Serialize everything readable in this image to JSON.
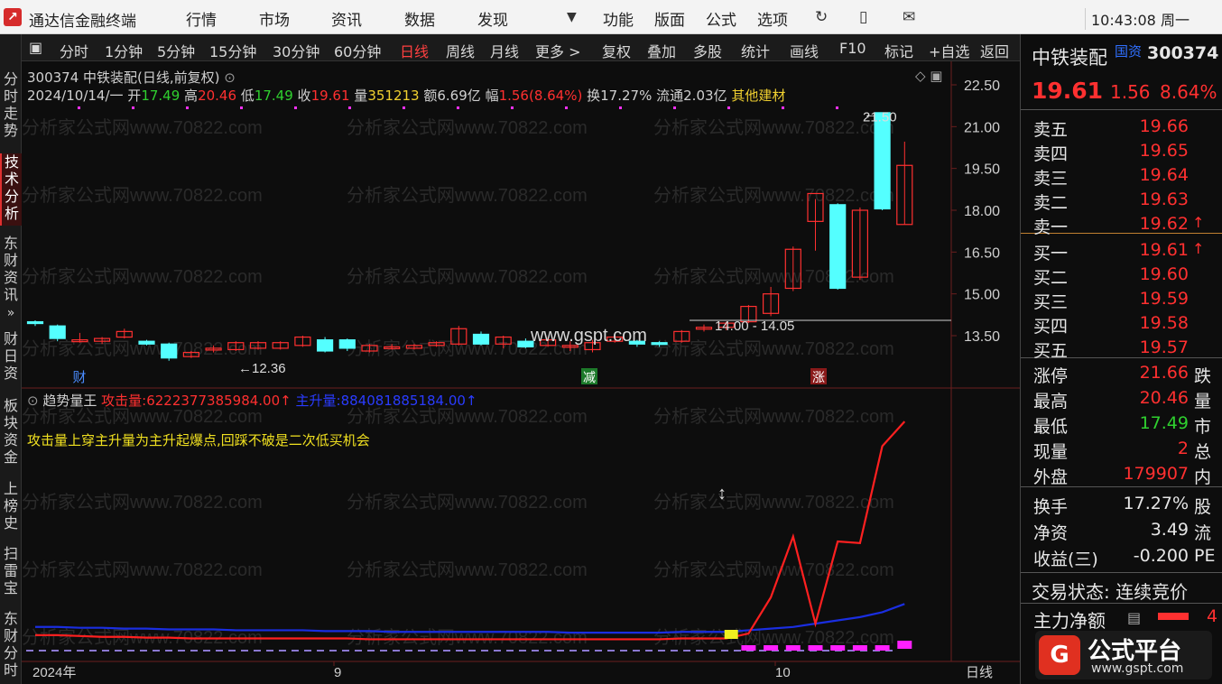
{
  "app": {
    "title": "通达信金融终端",
    "menus": [
      "行情",
      "市场",
      "资讯",
      "数据",
      "发现",
      "功能",
      "版面",
      "公式",
      "选项"
    ],
    "clock": "10:43:08 周一"
  },
  "left_tabs": [
    "分时走势",
    "技术分析",
    "东财资讯",
    "财日资",
    "板块资金",
    "上榜史",
    "扫雷宝",
    "东财分时"
  ],
  "period_bar": {
    "items": [
      "分时",
      "1分钟",
      "5分钟",
      "15分钟",
      "30分钟",
      "60分钟",
      "日线",
      "周线",
      "月线",
      "更多 >",
      "复权",
      "叠加",
      "多股",
      "统计",
      "画线",
      "F10",
      "标记",
      "+自选",
      "返回"
    ],
    "active": "日线"
  },
  "stock": {
    "header": "300374 中铁装配(日线,前复权)",
    "date": "2024/10/14/一",
    "open_label": "开",
    "open": "17.49",
    "high_label": "高",
    "high": "20.46",
    "low_label": "低",
    "low": "17.49",
    "close_label": "收",
    "close": "19.61",
    "vol_label": "量",
    "vol": "351213",
    "amt_label": "额",
    "amt": "6.69亿",
    "chg_label": "幅",
    "chg": "1.56(8.64%)",
    "turn_label": "换",
    "turn": "17.27%",
    "float_label": "流通",
    "float": "2.03亿",
    "sector": "其他建材"
  },
  "annotations": {
    "high_mark": "21.50",
    "low_mark": "←12.36",
    "range_mark": "14.00 - 14.05",
    "watermark_url": "www.gspt.com",
    "event_cai": "财",
    "event_jian": "减",
    "event_zhang": "涨"
  },
  "indicator": {
    "name": "趋势量王",
    "attack_label": "攻击量:",
    "attack_value": "6222377385984.00↑",
    "main_label": "主升量:",
    "main_value": "884081885184.00↑",
    "note": "攻击量上穿主升量为主升起爆点,回踩不破是二次低买机会"
  },
  "x_axis": [
    "2024年",
    "9",
    "10"
  ],
  "period_label": "日线",
  "y_axis": [
    "22.50",
    "21.00",
    "19.50",
    "18.00",
    "16.50",
    "15.00",
    "13.50"
  ],
  "watermark": "分析家公式网www.70822.com",
  "quote": {
    "name": "中铁装配",
    "tag": "国资",
    "code": "300374",
    "price": "19.61",
    "change": "1.56",
    "pct": "8.64%",
    "asks": [
      {
        "label": "卖五",
        "price": "19.66",
        "flag": ""
      },
      {
        "label": "卖四",
        "price": "19.65",
        "flag": ""
      },
      {
        "label": "卖三",
        "price": "19.64",
        "flag": ""
      },
      {
        "label": "卖二",
        "price": "19.63",
        "flag": ""
      },
      {
        "label": "卖一",
        "price": "19.62",
        "flag": "↑"
      }
    ],
    "bids": [
      {
        "label": "买一",
        "price": "19.61",
        "flag": "↑"
      },
      {
        "label": "买二",
        "price": "19.60",
        "flag": ""
      },
      {
        "label": "买三",
        "price": "19.59",
        "flag": ""
      },
      {
        "label": "买四",
        "price": "19.58",
        "flag": ""
      },
      {
        "label": "买五",
        "price": "19.57",
        "flag": ""
      }
    ],
    "stats": [
      {
        "label": "涨停",
        "value": "21.66",
        "label2": "跌"
      },
      {
        "label": "最高",
        "value": "20.46",
        "label2": "量"
      },
      {
        "label": "最低",
        "value": "17.49",
        "label2": "市"
      },
      {
        "label": "现量",
        "value": "2",
        "label2": "总"
      },
      {
        "label": "外盘",
        "value": "179907",
        "label2": "内"
      }
    ],
    "stats2": [
      {
        "label": "换手",
        "value": "17.27%",
        "label2": "股"
      },
      {
        "label": "净资",
        "value": "3.49",
        "label2": "流"
      },
      {
        "label": "收益(三)",
        "value": "-0.200",
        "label2": "PE"
      }
    ],
    "trade_status": "交易状态: 连续竞价",
    "main_flow_label": "主力净额",
    "main_flow_value": "4"
  },
  "brand": {
    "name": "公式平台",
    "url": "www.gspt.com"
  },
  "colors": {
    "up": "#ff3030",
    "down": "#54ffff",
    "attack": "#ff2020",
    "main": "#1a2ee0"
  },
  "candles": [
    [
      14.0,
      14.05,
      13.85,
      13.95
    ],
    [
      13.85,
      13.9,
      13.3,
      13.4
    ],
    [
      13.3,
      13.6,
      13.25,
      13.35
    ],
    [
      13.3,
      13.45,
      13.2,
      13.4
    ],
    [
      13.45,
      13.75,
      13.4,
      13.65
    ],
    [
      13.3,
      13.35,
      13.15,
      13.2
    ],
    [
      13.2,
      13.25,
      12.6,
      12.7
    ],
    [
      12.75,
      12.95,
      12.7,
      12.9
    ],
    [
      13.0,
      13.15,
      12.9,
      13.05
    ],
    [
      13.0,
      13.3,
      12.95,
      13.25
    ],
    [
      13.05,
      13.3,
      13.0,
      13.25
    ],
    [
      13.05,
      13.3,
      13.0,
      13.25
    ],
    [
      13.15,
      13.5,
      13.1,
      13.45
    ],
    [
      13.35,
      13.45,
      12.9,
      12.95
    ],
    [
      13.35,
      13.4,
      12.95,
      13.05
    ],
    [
      12.95,
      13.2,
      12.9,
      13.15
    ],
    [
      13.05,
      13.2,
      13.0,
      13.1
    ],
    [
      13.05,
      13.2,
      13.0,
      13.15
    ],
    [
      13.15,
      13.3,
      13.1,
      13.25
    ],
    [
      13.2,
      13.85,
      13.15,
      13.75
    ],
    [
      13.55,
      13.65,
      13.15,
      13.2
    ],
    [
      13.2,
      13.5,
      13.05,
      13.45
    ],
    [
      13.3,
      13.4,
      13.05,
      13.1
    ],
    [
      13.15,
      13.45,
      13.1,
      13.35
    ],
    [
      13.1,
      13.3,
      12.95,
      13.15
    ],
    [
      13.0,
      13.35,
      12.9,
      13.25
    ],
    [
      13.3,
      13.5,
      13.25,
      13.45
    ],
    [
      13.3,
      13.35,
      13.1,
      13.2
    ],
    [
      13.25,
      13.3,
      13.1,
      13.2
    ],
    [
      13.3,
      13.7,
      13.25,
      13.65
    ],
    [
      13.75,
      13.9,
      13.65,
      13.8
    ],
    [
      13.8,
      14.0,
      13.7,
      13.95
    ],
    [
      14.0,
      14.6,
      13.95,
      14.55
    ],
    [
      14.3,
      15.25,
      14.2,
      15.0
    ],
    [
      15.2,
      16.7,
      15.1,
      16.6
    ],
    [
      17.6,
      18.4,
      16.55,
      18.6
    ],
    [
      18.2,
      18.25,
      15.15,
      15.2
    ],
    [
      15.6,
      18.1,
      15.5,
      18.0
    ],
    [
      21.5,
      21.5,
      18.0,
      18.05
    ],
    [
      17.49,
      20.46,
      17.49,
      19.61
    ]
  ],
  "indicator_series": {
    "main": [
      1.0,
      1.0,
      0.95,
      0.95,
      0.9,
      0.9,
      0.85,
      0.85,
      0.85,
      0.8,
      0.8,
      0.8,
      0.8,
      0.75,
      0.75,
      0.75,
      0.7,
      0.7,
      0.7,
      0.7,
      0.7,
      0.7,
      0.7,
      0.7,
      0.65,
      0.65,
      0.65,
      0.65,
      0.65,
      0.7,
      0.7,
      0.7,
      0.8,
      0.9,
      1.0,
      1.2,
      1.4,
      1.6,
      1.9,
      2.4
    ],
    "attack": [
      0.5,
      0.5,
      0.45,
      0.4,
      0.4,
      0.35,
      0.35,
      0.3,
      0.3,
      0.3,
      0.3,
      0.3,
      0.3,
      0.3,
      0.3,
      0.25,
      0.25,
      0.25,
      0.25,
      0.25,
      0.25,
      0.25,
      0.25,
      0.25,
      0.25,
      0.25,
      0.25,
      0.25,
      0.25,
      0.3,
      0.3,
      0.3,
      0.6,
      2.8,
      6.5,
      1.2,
      6.2,
      6.1,
      12.0,
      13.5
    ]
  }
}
